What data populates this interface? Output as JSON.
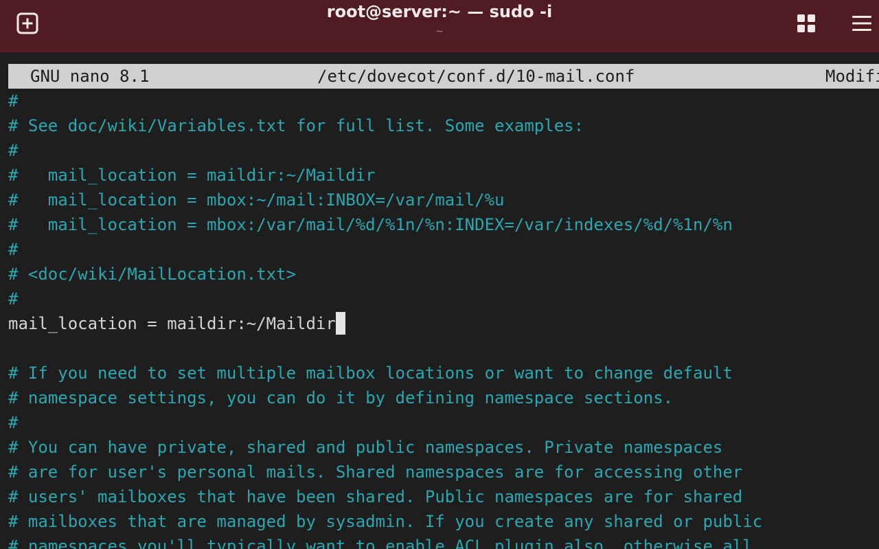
{
  "window": {
    "title": "root@server:~ — sudo -i",
    "subtitle": "~"
  },
  "icons": {
    "new_tab": "new-tab-icon",
    "view": "grid-icon",
    "menu": "hamburger-menu-icon"
  },
  "colors": {
    "titlebar": "#511c21",
    "terminal_bg": "#1e1e1e",
    "comment": "#2aa7b0",
    "text": "#d4d4d4",
    "header_bg": "#d0d0d0"
  },
  "nano": {
    "version": "GNU nano 8.1",
    "filename": "/etc/dovecot/conf.d/10-mail.conf",
    "status": "Modified"
  },
  "lines": [
    {
      "text": "#",
      "kind": "comment"
    },
    {
      "text": "# See doc/wiki/Variables.txt for full list. Some examples:",
      "kind": "comment"
    },
    {
      "text": "#",
      "kind": "comment"
    },
    {
      "text": "#   mail_location = maildir:~/Maildir",
      "kind": "comment"
    },
    {
      "text": "#   mail_location = mbox:~/mail:INBOX=/var/mail/%u",
      "kind": "comment"
    },
    {
      "text": "#   mail_location = mbox:/var/mail/%d/%1n/%n:INDEX=/var/indexes/%d/%1n/%n",
      "kind": "comment"
    },
    {
      "text": "#",
      "kind": "comment"
    },
    {
      "text": "# <doc/wiki/MailLocation.txt>",
      "kind": "comment"
    },
    {
      "text": "#",
      "kind": "comment"
    },
    {
      "text": "mail_location = maildir:~/Maildir",
      "kind": "code",
      "cursor": true
    },
    {
      "text": "",
      "kind": "code"
    },
    {
      "text": "# If you need to set multiple mailbox locations or want to change default",
      "kind": "comment"
    },
    {
      "text": "# namespace settings, you can do it by defining namespace sections.",
      "kind": "comment"
    },
    {
      "text": "#",
      "kind": "comment"
    },
    {
      "text": "# You can have private, shared and public namespaces. Private namespaces",
      "kind": "comment"
    },
    {
      "text": "# are for user's personal mails. Shared namespaces are for accessing other",
      "kind": "comment"
    },
    {
      "text": "# users' mailboxes that have been shared. Public namespaces are for shared",
      "kind": "comment"
    },
    {
      "text": "# mailboxes that are managed by sysadmin. If you create any shared or public",
      "kind": "comment"
    },
    {
      "text": "# namespaces you'll typically want to enable ACL plugin also, otherwise all",
      "kind": "comment"
    }
  ]
}
